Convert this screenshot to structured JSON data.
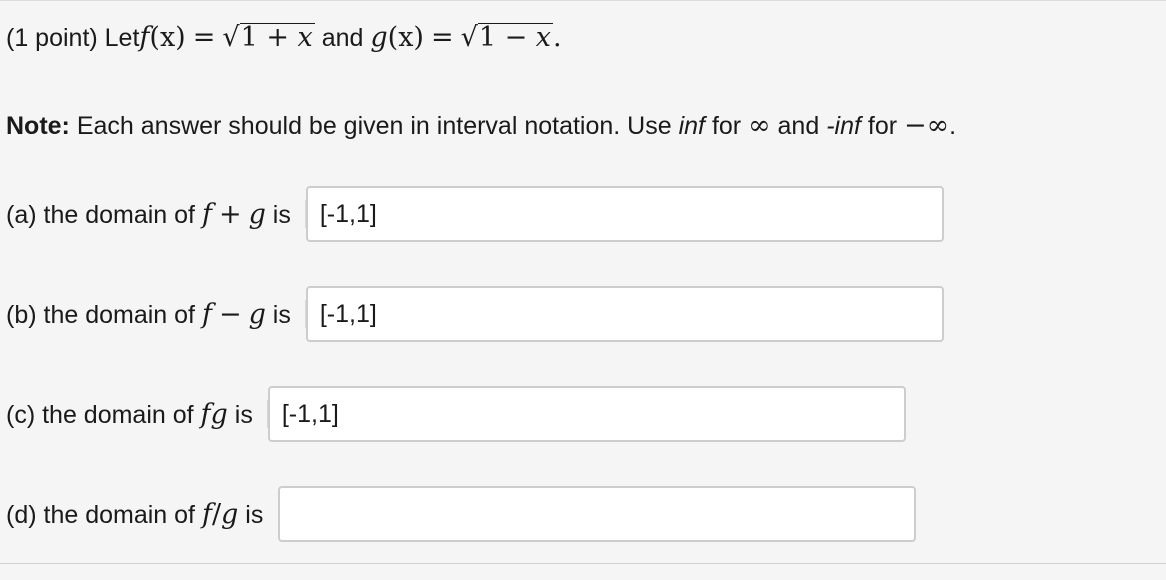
{
  "problem": {
    "prefix": "(1 point) Let ",
    "f_name": "f",
    "f_arg": "(x)",
    "equals": "=",
    "sqrt_sign": "√",
    "f_radicand_1": "1 + ",
    "f_radicand_x": "x",
    "and": " and ",
    "g_name": "g",
    "g_arg": "(x)",
    "g_radicand_1": "1 − ",
    "g_radicand_x": "x",
    "period": "."
  },
  "note": {
    "bold": "Note:",
    "text1": " Each answer should be given in interval notation. Use ",
    "inf": "inf",
    "text2": " for ",
    "infinity_symbol": "∞",
    "text3": " and ",
    "neg_inf": "-inf",
    "text4": " for ",
    "neg_infinity_symbol": "−∞",
    "text5": "."
  },
  "questions": [
    {
      "prefix": "(a) the domain of ",
      "math_f": "f",
      "math_op": "+",
      "math_g": "g",
      "suffix": " is",
      "answer": "[-1,1]",
      "placeholder": ""
    },
    {
      "prefix": "(b) the domain of ",
      "math_f": "f",
      "math_op": "−",
      "math_g": "g",
      "suffix": " is",
      "answer": "[-1,1]",
      "placeholder": ""
    },
    {
      "prefix": "(c) the domain of ",
      "math_f": "f",
      "math_op": "",
      "math_g": "g",
      "suffix": " is",
      "answer": "[-1,1]",
      "placeholder": ""
    },
    {
      "prefix": "(d) the domain of ",
      "math_f": "f",
      "math_op": "/",
      "math_g": "g",
      "suffix": " is",
      "answer": "",
      "placeholder": ""
    }
  ]
}
